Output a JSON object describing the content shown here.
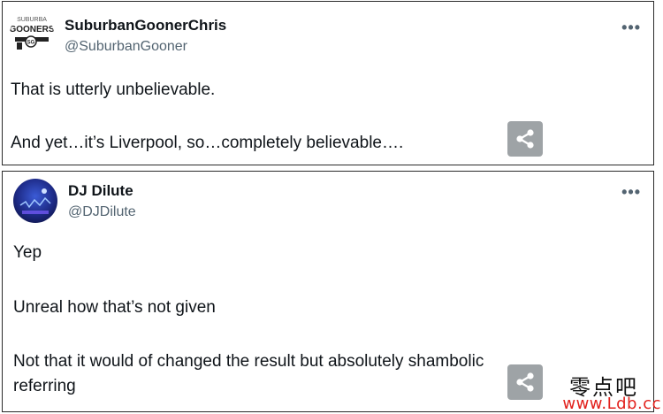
{
  "tweets": [
    {
      "display_name": "SuburbanGoonerChris",
      "handle": "@SuburbanGooner",
      "avatar_text_top": "SUBURBA",
      "avatar_text_main": "GOONERS",
      "avatar_text_badge": "SG",
      "more_label": "•••",
      "lines": [
        "That is utterly unbelievable.",
        "And yet…it’s Liverpool, so…completely believable…."
      ]
    },
    {
      "display_name": "DJ Dilute",
      "handle": "@DJDilute",
      "more_label": "•••",
      "lines": [
        "Yep",
        "Unreal how that’s not given",
        "Not that it would of changed the result but absolutely shambolic",
        "referring"
      ]
    }
  ],
  "watermark": {
    "cn_text": "零点吧",
    "url_text": "www.Ldb.cc"
  },
  "icons": {
    "share": "share-icon",
    "more": "more-icon"
  },
  "colors": {
    "share_bg": "#9ea3a6",
    "handle": "#536471",
    "watermark_url": "#e2211c"
  }
}
